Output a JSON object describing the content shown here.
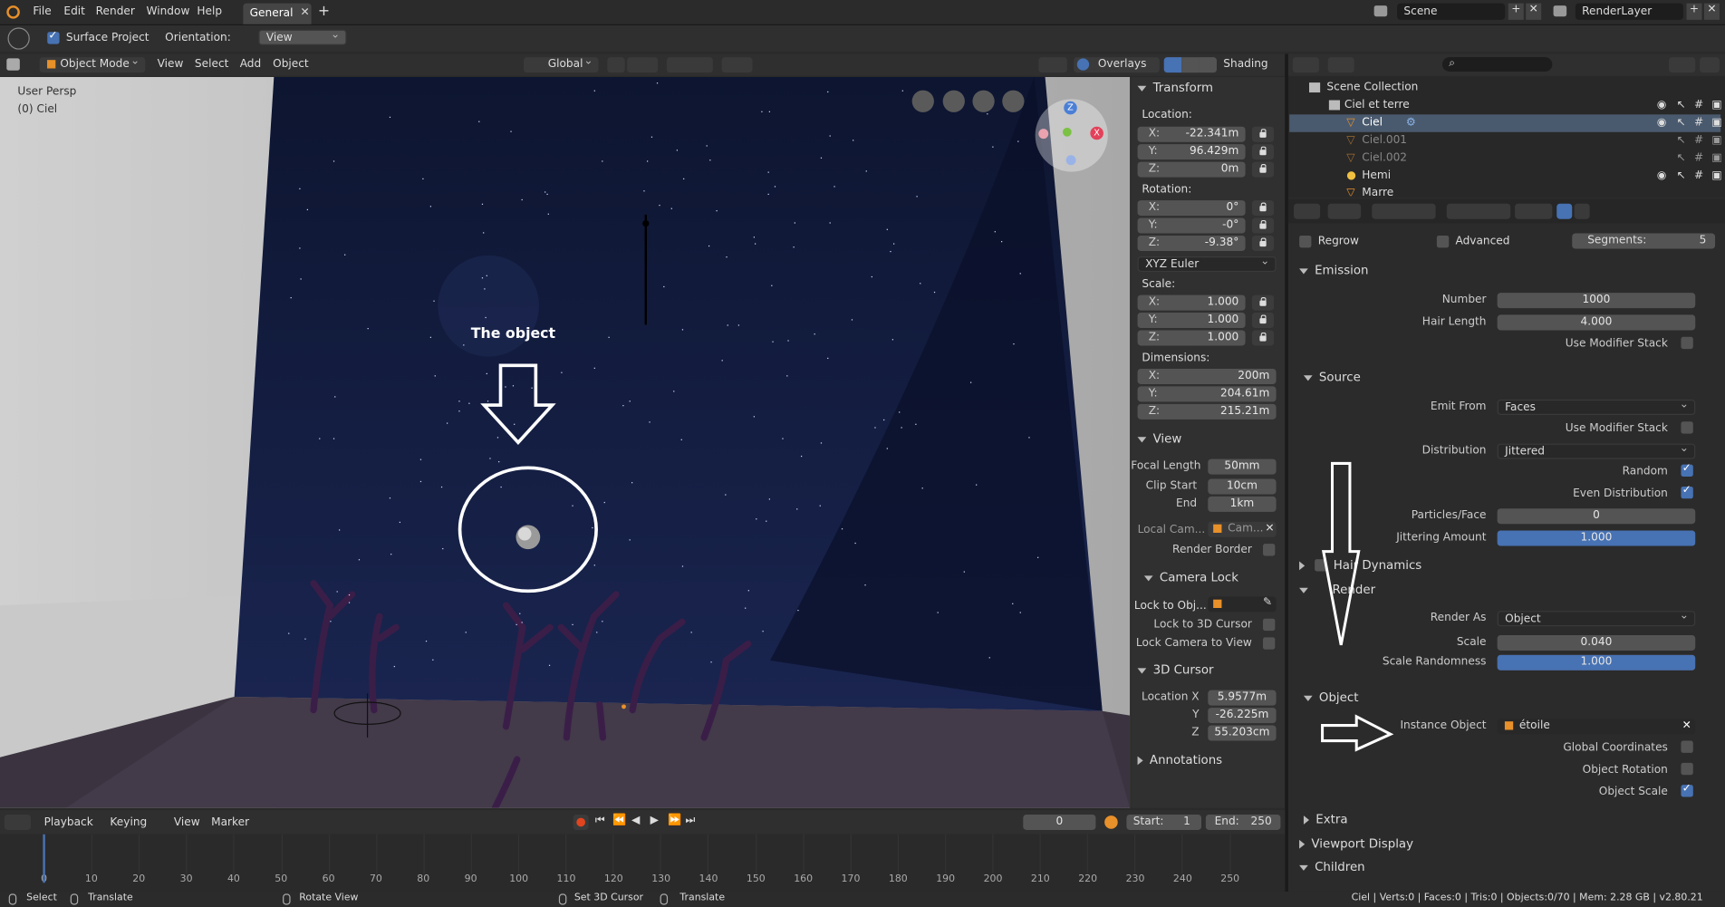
{
  "topbar": {
    "menus": [
      "File",
      "Edit",
      "Render",
      "Window",
      "Help"
    ],
    "workspace_tab": "General",
    "scene": "Scene",
    "render_layer": "RenderLayer"
  },
  "toolheader": {
    "surface_project": "Surface Project",
    "orientation_label": "Orientation:",
    "orientation_value": "View"
  },
  "viewport_header": {
    "mode": "Object Mode",
    "menus": [
      "View",
      "Select",
      "Add",
      "Object"
    ],
    "transform_space": "Global",
    "overlays": "Overlays",
    "shading": "Shading"
  },
  "viewport": {
    "view_name": "User Persp",
    "object_name": "(0) Ciel",
    "annotation_text": "The object"
  },
  "n_panel": {
    "transform_title": "Transform",
    "location_label": "Location:",
    "location": {
      "x": "-22.341m",
      "y": "96.429m",
      "z": "0m"
    },
    "rotation_label": "Rotation:",
    "rotation": {
      "x": "0°",
      "y": "-0°",
      "z": "-9.38°"
    },
    "rotation_mode": "XYZ Euler",
    "scale_label": "Scale:",
    "scale": {
      "x": "1.000",
      "y": "1.000",
      "z": "1.000"
    },
    "dimensions_label": "Dimensions:",
    "dimensions": {
      "x": "200m",
      "y": "204.61m",
      "z": "215.21m"
    },
    "axes": {
      "x": "X:",
      "y": "Y:",
      "z": "Z:"
    },
    "view_title": "View",
    "focal_length_label": "Focal Length",
    "focal_length": "50mm",
    "clip_start_label": "Clip Start",
    "clip_start": "10cm",
    "end_label": "End",
    "clip_end": "1km",
    "local_camera_label": "Local Cam...",
    "local_camera_value": "Cam...",
    "render_border_label": "Render Border",
    "camera_lock_title": "Camera Lock",
    "lock_to_object_label": "Lock to Obj...",
    "lock_to_3d_cursor_label": "Lock to 3D Cursor",
    "lock_camera_to_view_label": "Lock Camera to View",
    "cursor_title": "3D Cursor",
    "cursor_location_label": "Location X",
    "cursor_y_label": "Y",
    "cursor_z_label": "Z",
    "cursor": {
      "x": "5.9577m",
      "y": "-26.225m",
      "z": "55.203cm"
    },
    "annotations_title": "Annotations"
  },
  "outliner": {
    "rows": [
      {
        "label": "Scene Collection"
      },
      {
        "label": "Ciel et terre"
      },
      {
        "label": "Ciel"
      },
      {
        "label": "Ciel.001"
      },
      {
        "label": "Ciel.002"
      },
      {
        "label": "Hemi"
      },
      {
        "label": "Marre"
      }
    ]
  },
  "properties": {
    "regrow_label": "Regrow",
    "advanced_label": "Advanced",
    "segments_label": "Segments:",
    "segments_value": "5",
    "emission_title": "Emission",
    "number_label": "Number",
    "number_value": "1000",
    "hair_length_label": "Hair Length",
    "hair_length_value": "4.000",
    "use_modifier_stack_label": "Use Modifier Stack",
    "source_title": "Source",
    "emit_from_label": "Emit From",
    "emit_from_value": "Faces",
    "use_modifier_stack_label2": "Use Modifier Stack",
    "distribution_label": "Distribution",
    "distribution_value": "Jittered",
    "random_label": "Random",
    "even_distribution_label": "Even Distribution",
    "particles_face_label": "Particles/Face",
    "particles_face_value": "0",
    "jittering_amount_label": "Jittering Amount",
    "jittering_amount_value": "1.000",
    "jittering_amount_fraction": 1.0,
    "hair_dynamics_title": "Hair Dynamics",
    "render_title": "Render",
    "render_as_label": "Render As",
    "render_as_value": "Object",
    "scale_label": "Scale",
    "scale_value": "0.040",
    "scale_randomness_label": "Scale Randomness",
    "scale_randomness_value": "1.000",
    "scale_randomness_fraction": 1.0,
    "object_title": "Object",
    "instance_object_label": "Instance Object",
    "instance_object_value": "étoile",
    "global_coordinates_label": "Global Coordinates",
    "object_rotation_label": "Object Rotation",
    "object_scale_label": "Object Scale",
    "extra_title": "Extra",
    "viewport_display_title": "Viewport Display",
    "children_title": "Children"
  },
  "timeline": {
    "menus": [
      "Playback",
      "Keying",
      "View",
      "Marker"
    ],
    "current_frame": "0",
    "start_label": "Start:",
    "start_value": "1",
    "end_label": "End:",
    "end_value": "250",
    "ruler_labels": [
      "0",
      "10",
      "20",
      "30",
      "40",
      "50",
      "60",
      "70",
      "80",
      "90",
      "100",
      "110",
      "120",
      "130",
      "140",
      "150",
      "160",
      "170",
      "180",
      "190",
      "200",
      "210",
      "220",
      "230",
      "240",
      "250"
    ]
  },
  "statusbar": {
    "select": "Select",
    "translate": "Translate",
    "rotate_view": "Rotate View",
    "set_3d_cursor": "Set 3D Cursor",
    "translate2": "Translate",
    "stats": "Ciel | Verts:0 | Faces:0 | Tris:0 | Objects:0/70 | Mem: 2.28 GB | v2.80.21"
  },
  "colors": {
    "accent_blue": "#4772b3",
    "object_orange": "#e8902a",
    "sky_top": "#0d1530",
    "sky_bottom": "#1a2550"
  }
}
